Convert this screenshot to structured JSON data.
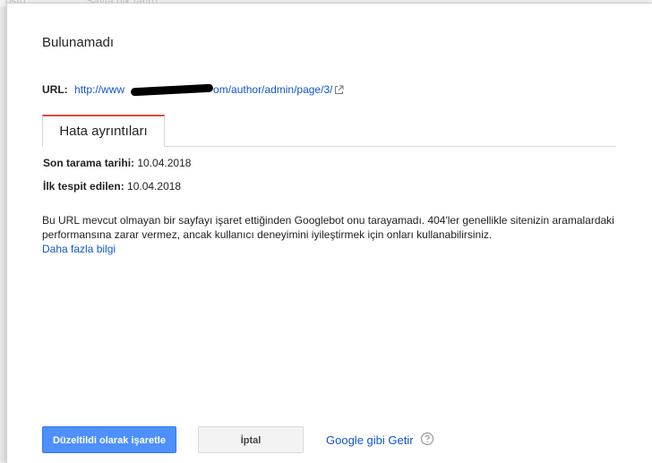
{
  "background": {
    "fragment_1": "ostu",
    "fragment_2": "Sayfa (ilk tarih)"
  },
  "dialog": {
    "title": "Bulunamadı",
    "url_label": "URL:",
    "url_prefix": "http://www",
    "url_suffix": "om/author/admin/page/3/",
    "tab_label": "Hata ayrıntıları",
    "last_crawled_label": "Son tarama tarihi:",
    "last_crawled_value": "10.04.2018",
    "first_detected_label": "İlk tespit edilen:",
    "first_detected_value": "10.04.2018",
    "description": "Bu URL mevcut olmayan bir sayfayı işaret ettiğinden Googlebot onu tarayamadı. 404'ler genellikle sitenizin aramalardaki performansına zarar vermez, ancak kullanıcı deneyimini iyileştirmek için onları kullanabilirsiniz.",
    "more_info_link": "Daha fazla bilgi",
    "mark_fixed_button": "Düzeltildi olarak işaretle",
    "cancel_button": "İptal",
    "fetch_as_google_link": "Google gibi Getir"
  },
  "colors": {
    "primary": "#4d90fe",
    "link": "#1155cc",
    "tab_accent": "#dd4b39"
  },
  "icons": {
    "external_link": "external-link-icon",
    "help": "help-icon"
  }
}
